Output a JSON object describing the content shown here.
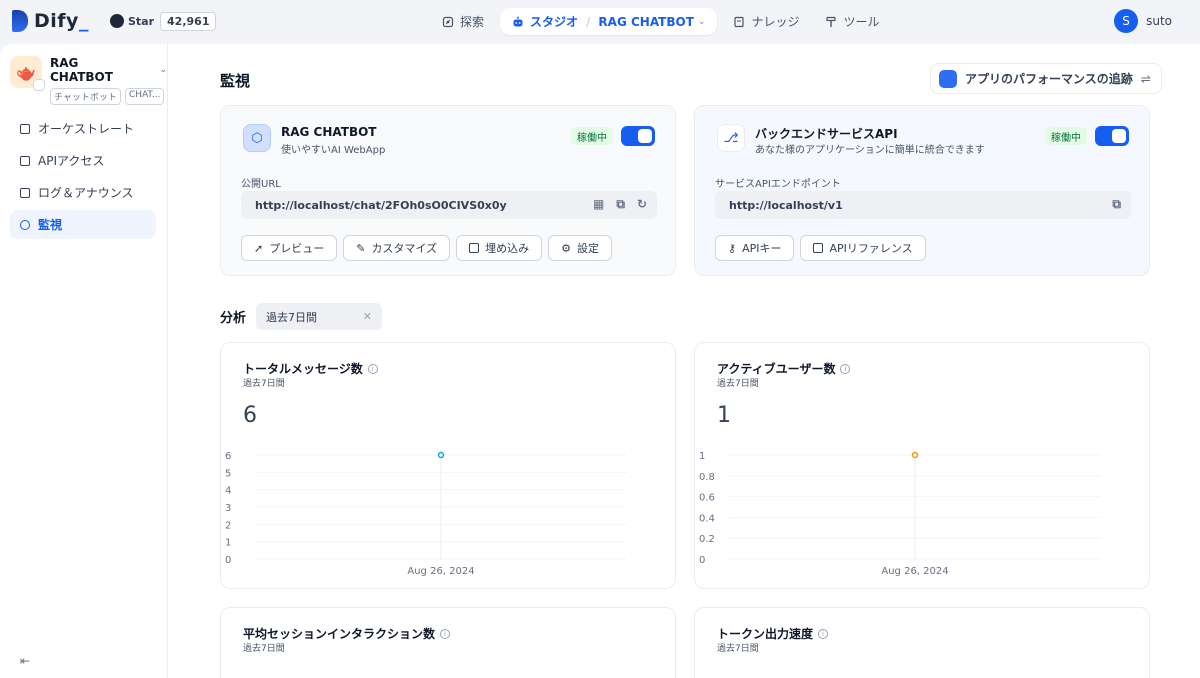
{
  "topbar": {
    "logo_text": "Dify",
    "github": {
      "star_label": "Star",
      "star_count": "42,961"
    },
    "nav": [
      {
        "label": "探索",
        "icon": "compass-icon"
      },
      {
        "label": "スタジオ",
        "icon": "robot-icon"
      },
      {
        "label": "ナレッジ",
        "icon": "book-icon"
      },
      {
        "label": "ツール",
        "icon": "hammer-icon"
      }
    ],
    "breadcrumb_app": "RAG CHATBOT",
    "user": {
      "initial": "S",
      "name": "suto"
    }
  },
  "sidebar": {
    "app_name": "RAG CHATBOT",
    "app_tags": [
      "チャットボット",
      "CHAT..."
    ],
    "items": [
      {
        "label": "オーケストレート",
        "icon": "layout-icon"
      },
      {
        "label": "APIアクセス",
        "icon": "terminal-icon"
      },
      {
        "label": "ログ＆アナウンス",
        "icon": "file-text-icon"
      },
      {
        "label": "監視",
        "icon": "gauge-icon"
      }
    ],
    "collapse_icon": "collapse-left-icon"
  },
  "main": {
    "title": "監視",
    "perf_button": "アプリのパフォーマンスの追跡",
    "webapp_card": {
      "title": "RAG CHATBOT",
      "subtitle": "使いやすいAI WebApp",
      "status": "稼働中",
      "url_label": "公開URL",
      "url": "http://localhost/chat/2FOh0sO0CIVS0x0y",
      "buttons": [
        "プレビュー",
        "カスタマイズ",
        "埋め込み",
        "設定"
      ]
    },
    "api_card": {
      "title": "バックエンドサービスAPI",
      "subtitle": "あなた様のアプリケーションに簡単に統合できます",
      "status": "稼働中",
      "url_label": "サービスAPIエンドポイント",
      "url": "http://localhost/v1",
      "buttons": [
        "APIキー",
        "APIリファレンス"
      ]
    },
    "analysis": {
      "label": "分析",
      "period": "過去7日間",
      "clear_icon": "x-icon"
    },
    "stats": [
      {
        "title": "トータルメッセージ数",
        "subtitle": "過去7日間",
        "value": "6"
      },
      {
        "title": "アクティブユーザー数",
        "subtitle": "過去7日間",
        "value": "1"
      },
      {
        "title": "平均セッションインタラクション数",
        "subtitle": "過去7日間",
        "value": ""
      },
      {
        "title": "トークン出力速度",
        "subtitle": "過去7日間",
        "value": ""
      }
    ]
  },
  "chart_data": [
    {
      "type": "line",
      "x": [
        "Aug 26, 2024"
      ],
      "series": [
        {
          "values": [
            6
          ]
        }
      ],
      "y_ticks": [
        "0",
        "1",
        "2",
        "3",
        "4",
        "5",
        "6"
      ],
      "ylim": [
        0,
        6
      ],
      "color": "#06aed4"
    },
    {
      "type": "line",
      "x": [
        "Aug 26, 2024"
      ],
      "series": [
        {
          "values": [
            1
          ]
        }
      ],
      "y_ticks": [
        "0",
        "0.2",
        "0.4",
        "0.6",
        "0.8",
        "1"
      ],
      "ylim": [
        0,
        1
      ],
      "color": "#f79009"
    }
  ]
}
